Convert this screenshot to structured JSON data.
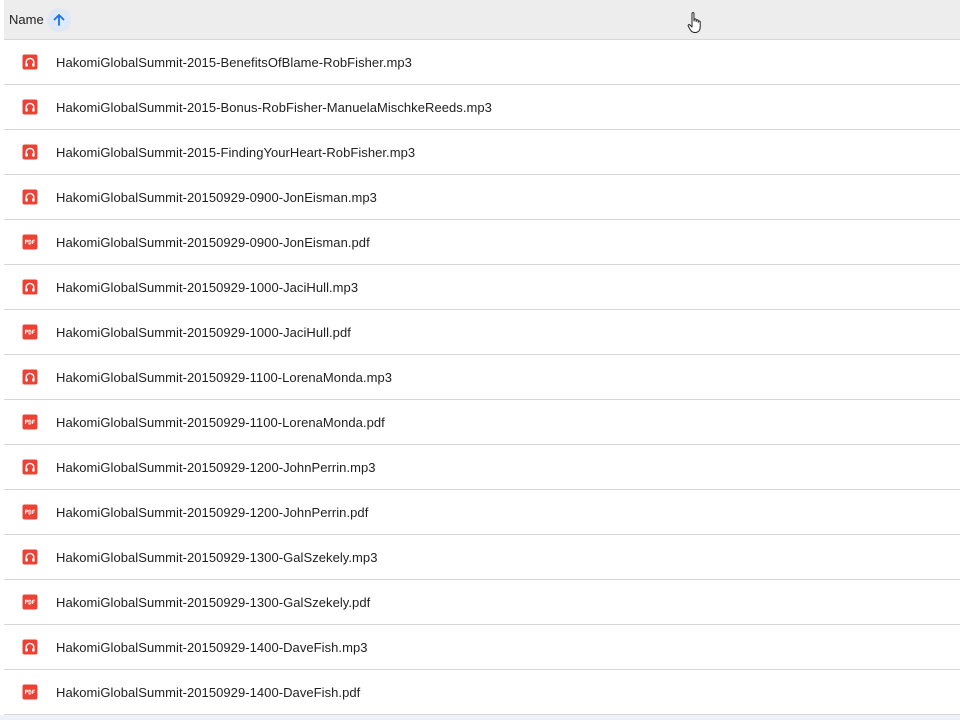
{
  "header": {
    "name_label": "Name",
    "sort_direction": "ascending"
  },
  "colors": {
    "file_icon_red": "#ea4335",
    "header_bg": "#ededed",
    "sort_accent": "#1a73e8"
  },
  "files": [
    {
      "name": "HakomiGlobalSummit-2015-BenefitsOfBlame-RobFisher.mp3",
      "icon": "audio-file-icon"
    },
    {
      "name": "HakomiGlobalSummit-2015-Bonus-RobFisher-ManuelaMischkeReeds.mp3",
      "icon": "audio-file-icon"
    },
    {
      "name": "HakomiGlobalSummit-2015-FindingYourHeart-RobFisher.mp3",
      "icon": "audio-file-icon"
    },
    {
      "name": "HakomiGlobalSummit-20150929-0900-JonEisman.mp3",
      "icon": "audio-file-icon"
    },
    {
      "name": "HakomiGlobalSummit-20150929-0900-JonEisman.pdf",
      "icon": "pdf-file-icon"
    },
    {
      "name": "HakomiGlobalSummit-20150929-1000-JaciHull.mp3",
      "icon": "audio-file-icon"
    },
    {
      "name": "HakomiGlobalSummit-20150929-1000-JaciHull.pdf",
      "icon": "pdf-file-icon"
    },
    {
      "name": "HakomiGlobalSummit-20150929-1100-LorenaMonda.mp3",
      "icon": "audio-file-icon"
    },
    {
      "name": "HakomiGlobalSummit-20150929-1100-LorenaMonda.pdf",
      "icon": "pdf-file-icon"
    },
    {
      "name": "HakomiGlobalSummit-20150929-1200-JohnPerrin.mp3",
      "icon": "audio-file-icon"
    },
    {
      "name": "HakomiGlobalSummit-20150929-1200-JohnPerrin.pdf",
      "icon": "pdf-file-icon"
    },
    {
      "name": "HakomiGlobalSummit-20150929-1300-GalSzekely.mp3",
      "icon": "audio-file-icon"
    },
    {
      "name": "HakomiGlobalSummit-20150929-1300-GalSzekely.pdf",
      "icon": "pdf-file-icon"
    },
    {
      "name": "HakomiGlobalSummit-20150929-1400-DaveFish.mp3",
      "icon": "audio-file-icon"
    },
    {
      "name": "HakomiGlobalSummit-20150929-1400-DaveFish.pdf",
      "icon": "pdf-file-icon"
    }
  ]
}
